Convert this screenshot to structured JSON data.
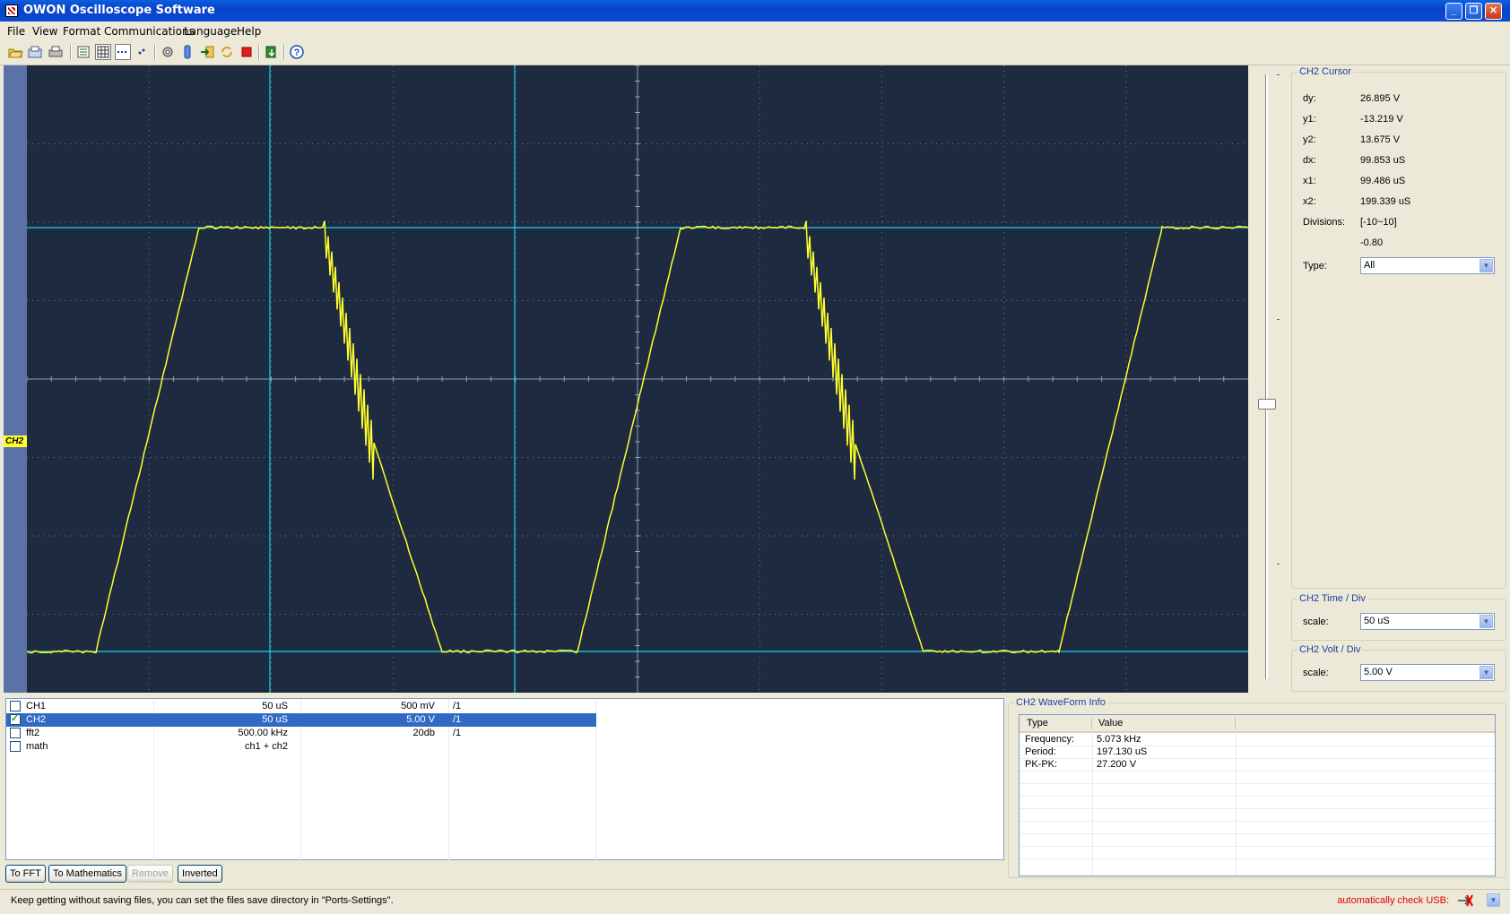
{
  "window": {
    "title": "OWON Oscilloscope Software"
  },
  "menu": [
    "File",
    "View",
    "Format",
    "Communications",
    "Language",
    "Help"
  ],
  "toolbar_icons": [
    "open-icon",
    "save-icon",
    "print-icon",
    "list-icon",
    "grid-icon",
    "dots-icon",
    "mini-dots-icon",
    "settings-icon",
    "battery-icon",
    "export-icon",
    "refresh-icon",
    "stop-icon",
    "download-icon",
    "help-icon"
  ],
  "scope": {
    "channel_marker": "CH2",
    "waveform_color": "#ffff2e",
    "cursor_color": "#1fd3e6",
    "background": "#1d2a3f"
  },
  "cursor_panel": {
    "title": "CH2 Cursor",
    "rows": [
      {
        "label": "dy:",
        "value": "26.895 V"
      },
      {
        "label": "y1:",
        "value": "-13.219 V"
      },
      {
        "label": "y2:",
        "value": "13.675 V"
      },
      {
        "label": "dx:",
        "value": "99.853 uS"
      },
      {
        "label": "x1:",
        "value": "99.486 uS"
      },
      {
        "label": "x2:",
        "value": "199.339 uS"
      },
      {
        "label": "Divisions:",
        "value": "[-10~10]"
      },
      {
        "label": "",
        "value": "-0.80"
      }
    ],
    "type_label": "Type:",
    "type_value": "All"
  },
  "time_div": {
    "title": "CH2 Time / Div",
    "label": "scale:",
    "value": "50 uS"
  },
  "volt_div": {
    "title": "CH2 Volt / Div",
    "label": "scale:",
    "value": "5.00 V"
  },
  "channels": [
    {
      "name": "CH1",
      "time": "50 uS",
      "volt": "500 mV",
      "probe": "/1",
      "checked": false,
      "selected": false
    },
    {
      "name": "CH2",
      "time": "50 uS",
      "volt": "5.00 V",
      "probe": "/1",
      "checked": true,
      "selected": true
    },
    {
      "name": "fft2",
      "time": "500.00 kHz",
      "volt": "20db",
      "probe": "/1",
      "checked": false,
      "selected": false
    },
    {
      "name": "math",
      "time": "ch1 + ch2",
      "volt": "",
      "probe": "",
      "checked": false,
      "selected": false
    }
  ],
  "buttons": {
    "to_fft": "To FFT",
    "to_math": "To Mathematics",
    "remove": "Remove",
    "inverted": "Inverted"
  },
  "waveform_info": {
    "title": "CH2 WaveForm Info",
    "headers": [
      "Type",
      "Value"
    ],
    "rows": [
      {
        "type": "Frequency:",
        "value": "5.073 kHz"
      },
      {
        "type": "Period:",
        "value": "197.130 uS"
      },
      {
        "type": "PK-PK:",
        "value": "27.200 V"
      }
    ]
  },
  "status": {
    "message": "Keep getting without saving files, you can set the files save directory in \"Ports-Settings\".",
    "usb": "automatically check USB:"
  }
}
